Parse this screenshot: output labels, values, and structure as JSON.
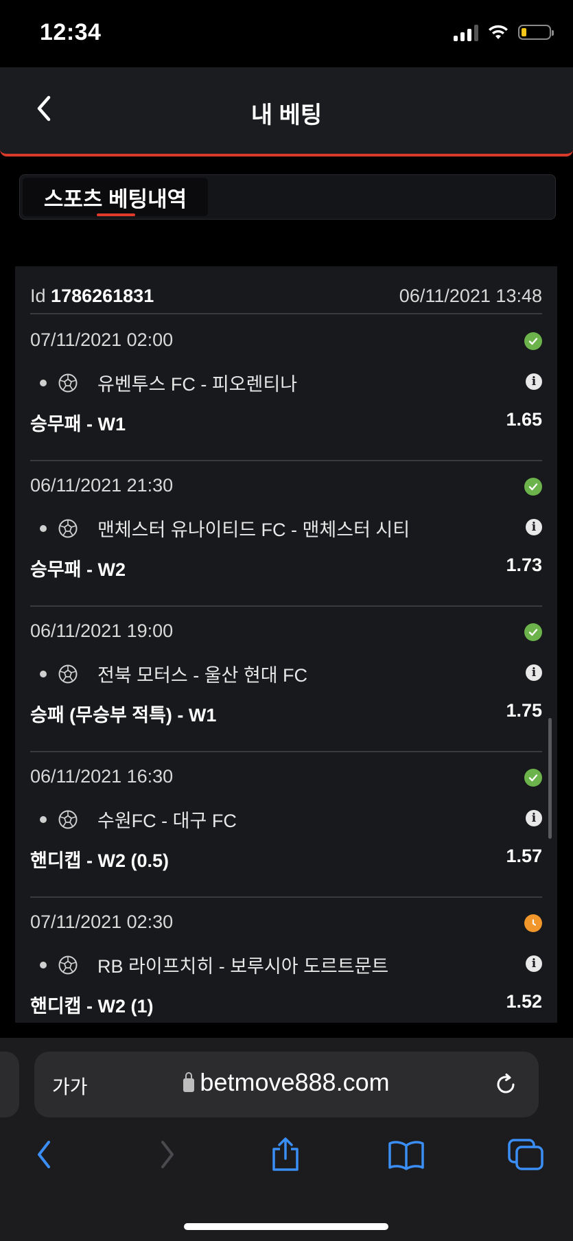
{
  "status_bar": {
    "time": "12:34"
  },
  "header": {
    "title": "내 베팅"
  },
  "tabs": [
    {
      "label": "스포츠 베팅내역",
      "active": true
    }
  ],
  "bet": {
    "id_label": "Id",
    "id_value": "1786261831",
    "placed": "06/11/2021 13:48",
    "legs": [
      {
        "date": "07/11/2021 02:00",
        "status": "won",
        "match": "유벤투스 FC - 피오렌티나",
        "market": "승무패 - W1",
        "odds": "1.65"
      },
      {
        "date": "06/11/2021 21:30",
        "status": "won",
        "match": "맨체스터 유나이티드 FC - 맨체스터 시티",
        "market": "승무패 - W2",
        "odds": "1.73"
      },
      {
        "date": "06/11/2021 19:00",
        "status": "won",
        "match": "전북 모터스 - 울산 현대 FC",
        "market": "승패 (무승부 적특) - W1",
        "odds": "1.75"
      },
      {
        "date": "06/11/2021 16:30",
        "status": "won",
        "match": "수원FC - 대구 FC",
        "market": "핸디캡 - W2 (0.5)",
        "odds": "1.57"
      },
      {
        "date": "07/11/2021 02:30",
        "status": "pending",
        "match": "RB 라이프치히 - 보루시아 도르트문트",
        "market": "핸디캡 - W2 (1)",
        "odds": "1.52"
      }
    ]
  },
  "browser": {
    "text_size": "가가",
    "url": "betmove888.com"
  },
  "colors": {
    "accent": "#e03a2a",
    "won": "#6bb34a",
    "pending": "#f0962a",
    "safari_blue": "#3a8ef6"
  },
  "icons": [
    "back-chevron-icon",
    "check-icon",
    "clock-icon",
    "soccer-ball-icon",
    "info-icon",
    "lock-icon",
    "reload-icon",
    "back-arrow-icon",
    "forward-arrow-icon",
    "share-icon",
    "bookmarks-icon",
    "tabs-icon"
  ]
}
